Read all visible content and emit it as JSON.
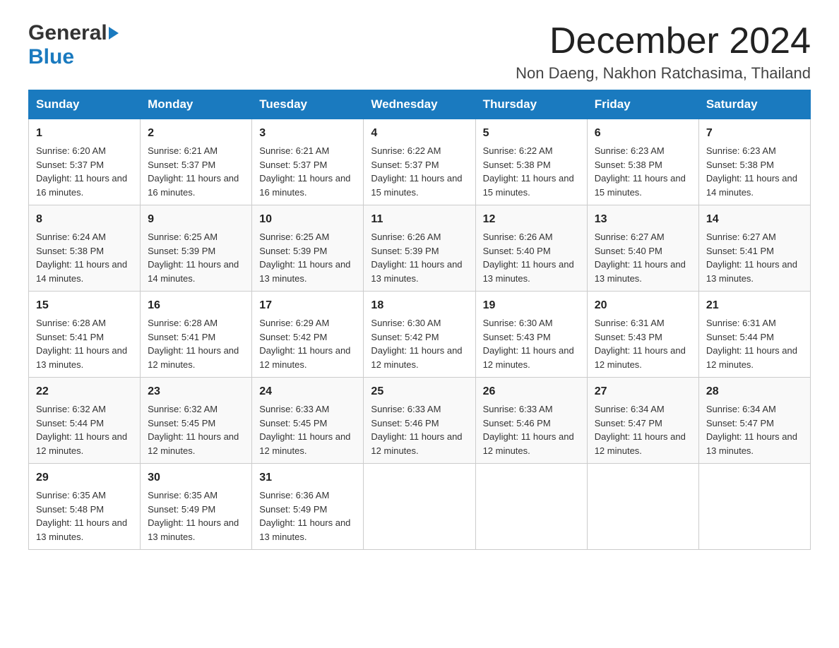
{
  "header": {
    "logo_general": "General",
    "logo_blue": "Blue",
    "month_title": "December 2024",
    "location": "Non Daeng, Nakhon Ratchasima, Thailand"
  },
  "weekdays": [
    "Sunday",
    "Monday",
    "Tuesday",
    "Wednesday",
    "Thursday",
    "Friday",
    "Saturday"
  ],
  "weeks": [
    [
      {
        "day": "1",
        "sunrise": "6:20 AM",
        "sunset": "5:37 PM",
        "daylight": "11 hours and 16 minutes."
      },
      {
        "day": "2",
        "sunrise": "6:21 AM",
        "sunset": "5:37 PM",
        "daylight": "11 hours and 16 minutes."
      },
      {
        "day": "3",
        "sunrise": "6:21 AM",
        "sunset": "5:37 PM",
        "daylight": "11 hours and 16 minutes."
      },
      {
        "day": "4",
        "sunrise": "6:22 AM",
        "sunset": "5:37 PM",
        "daylight": "11 hours and 15 minutes."
      },
      {
        "day": "5",
        "sunrise": "6:22 AM",
        "sunset": "5:38 PM",
        "daylight": "11 hours and 15 minutes."
      },
      {
        "day": "6",
        "sunrise": "6:23 AM",
        "sunset": "5:38 PM",
        "daylight": "11 hours and 15 minutes."
      },
      {
        "day": "7",
        "sunrise": "6:23 AM",
        "sunset": "5:38 PM",
        "daylight": "11 hours and 14 minutes."
      }
    ],
    [
      {
        "day": "8",
        "sunrise": "6:24 AM",
        "sunset": "5:38 PM",
        "daylight": "11 hours and 14 minutes."
      },
      {
        "day": "9",
        "sunrise": "6:25 AM",
        "sunset": "5:39 PM",
        "daylight": "11 hours and 14 minutes."
      },
      {
        "day": "10",
        "sunrise": "6:25 AM",
        "sunset": "5:39 PM",
        "daylight": "11 hours and 13 minutes."
      },
      {
        "day": "11",
        "sunrise": "6:26 AM",
        "sunset": "5:39 PM",
        "daylight": "11 hours and 13 minutes."
      },
      {
        "day": "12",
        "sunrise": "6:26 AM",
        "sunset": "5:40 PM",
        "daylight": "11 hours and 13 minutes."
      },
      {
        "day": "13",
        "sunrise": "6:27 AM",
        "sunset": "5:40 PM",
        "daylight": "11 hours and 13 minutes."
      },
      {
        "day": "14",
        "sunrise": "6:27 AM",
        "sunset": "5:41 PM",
        "daylight": "11 hours and 13 minutes."
      }
    ],
    [
      {
        "day": "15",
        "sunrise": "6:28 AM",
        "sunset": "5:41 PM",
        "daylight": "11 hours and 13 minutes."
      },
      {
        "day": "16",
        "sunrise": "6:28 AM",
        "sunset": "5:41 PM",
        "daylight": "11 hours and 12 minutes."
      },
      {
        "day": "17",
        "sunrise": "6:29 AM",
        "sunset": "5:42 PM",
        "daylight": "11 hours and 12 minutes."
      },
      {
        "day": "18",
        "sunrise": "6:30 AM",
        "sunset": "5:42 PM",
        "daylight": "11 hours and 12 minutes."
      },
      {
        "day": "19",
        "sunrise": "6:30 AM",
        "sunset": "5:43 PM",
        "daylight": "11 hours and 12 minutes."
      },
      {
        "day": "20",
        "sunrise": "6:31 AM",
        "sunset": "5:43 PM",
        "daylight": "11 hours and 12 minutes."
      },
      {
        "day": "21",
        "sunrise": "6:31 AM",
        "sunset": "5:44 PM",
        "daylight": "11 hours and 12 minutes."
      }
    ],
    [
      {
        "day": "22",
        "sunrise": "6:32 AM",
        "sunset": "5:44 PM",
        "daylight": "11 hours and 12 minutes."
      },
      {
        "day": "23",
        "sunrise": "6:32 AM",
        "sunset": "5:45 PM",
        "daylight": "11 hours and 12 minutes."
      },
      {
        "day": "24",
        "sunrise": "6:33 AM",
        "sunset": "5:45 PM",
        "daylight": "11 hours and 12 minutes."
      },
      {
        "day": "25",
        "sunrise": "6:33 AM",
        "sunset": "5:46 PM",
        "daylight": "11 hours and 12 minutes."
      },
      {
        "day": "26",
        "sunrise": "6:33 AM",
        "sunset": "5:46 PM",
        "daylight": "11 hours and 12 minutes."
      },
      {
        "day": "27",
        "sunrise": "6:34 AM",
        "sunset": "5:47 PM",
        "daylight": "11 hours and 12 minutes."
      },
      {
        "day": "28",
        "sunrise": "6:34 AM",
        "sunset": "5:47 PM",
        "daylight": "11 hours and 13 minutes."
      }
    ],
    [
      {
        "day": "29",
        "sunrise": "6:35 AM",
        "sunset": "5:48 PM",
        "daylight": "11 hours and 13 minutes."
      },
      {
        "day": "30",
        "sunrise": "6:35 AM",
        "sunset": "5:49 PM",
        "daylight": "11 hours and 13 minutes."
      },
      {
        "day": "31",
        "sunrise": "6:36 AM",
        "sunset": "5:49 PM",
        "daylight": "11 hours and 13 minutes."
      },
      null,
      null,
      null,
      null
    ]
  ],
  "labels": {
    "sunrise": "Sunrise:",
    "sunset": "Sunset:",
    "daylight": "Daylight:"
  }
}
